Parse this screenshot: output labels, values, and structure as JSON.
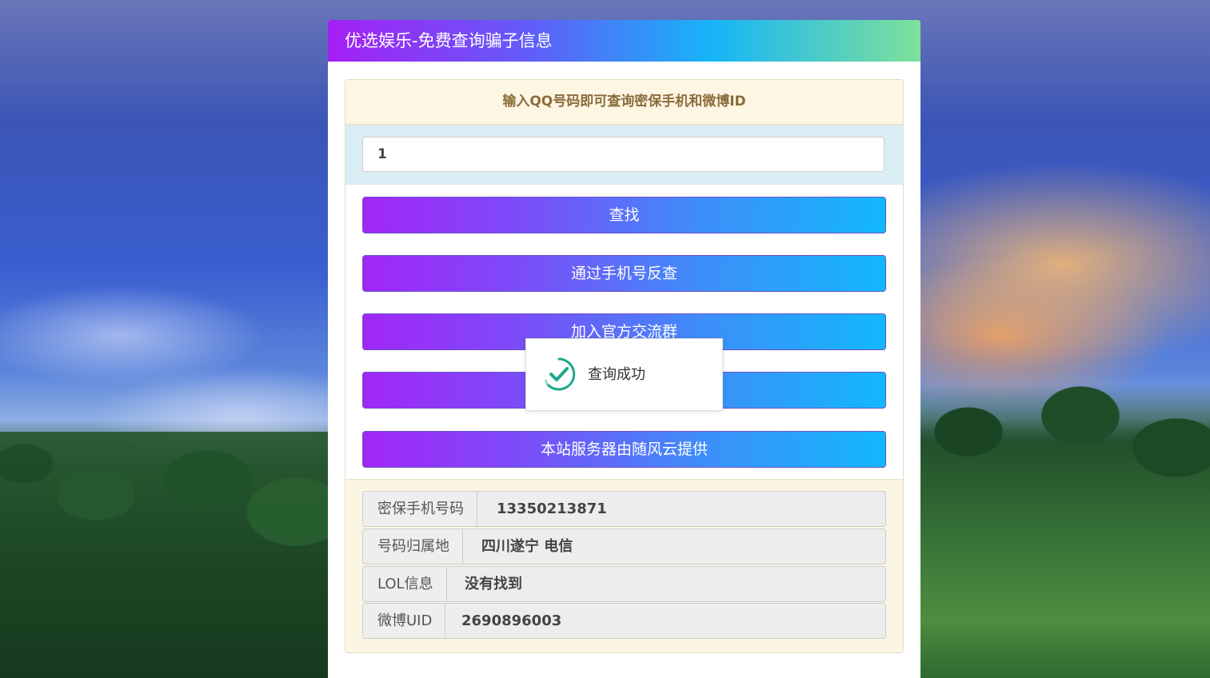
{
  "header": {
    "title": "优选娱乐-免费查询骗子信息"
  },
  "query": {
    "heading": "输入QQ号码即可查询密保手机和微博ID",
    "input_value": "1"
  },
  "buttons": [
    {
      "label": "查找"
    },
    {
      "label": "通过手机号反查"
    },
    {
      "label": "加入官方交流群"
    },
    {
      "label": ""
    },
    {
      "label": "本站服务器由随风云提供"
    }
  ],
  "results": [
    {
      "label": "密保手机号码",
      "value": "13350213871"
    },
    {
      "label": "号码归属地",
      "value": "四川遂宁 电信"
    },
    {
      "label": "LOL信息",
      "value": "没有找到"
    },
    {
      "label": "微博UID",
      "value": "2690896003"
    }
  ],
  "toast": {
    "message": "查询成功",
    "icon": "check-circle-icon",
    "icon_color": "#1aa98b"
  },
  "colors": {
    "button_gradient_start": "#a226f7",
    "button_gradient_end": "#12b8fb",
    "header_gradient_start": "#a61ff5",
    "header_gradient_end": "#7fe09a"
  }
}
